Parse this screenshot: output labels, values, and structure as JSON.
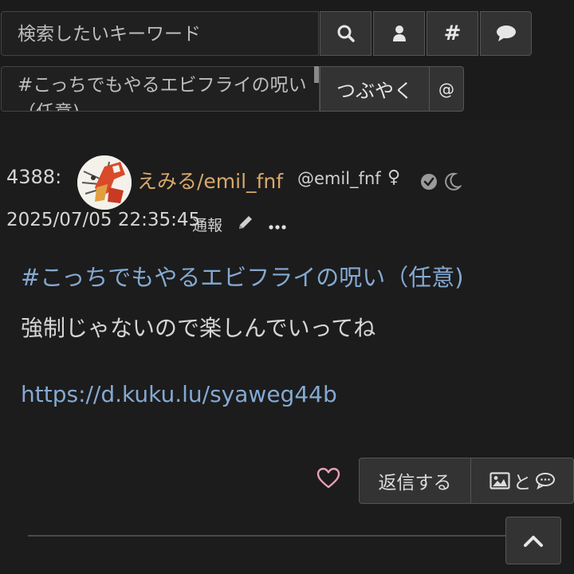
{
  "search": {
    "placeholder": "検索したいキーワード"
  },
  "toolbar": {
    "search_icon": "search-icon",
    "user_icon": "user-icon",
    "hashtag_label": "#",
    "comment_icon": "speech-bubble-icon"
  },
  "composer": {
    "value": "#こっちでもやるエビフライの呪い（任意)",
    "submit_label": "つぶやく",
    "mention_label": "@"
  },
  "post": {
    "number": "4388:",
    "display_name": "えみる/emil_fnf",
    "handle": "@emil_fnf",
    "gender_symbol": "♀",
    "timestamp": "2025/07/05 22:35:45",
    "report_label": "通報",
    "hashtag": "#こっちでもやるエビフライの呪い（任意)",
    "body": "強制じゃないので楽しんでいってね",
    "url": "https://d.kuku.lu/syaweg44b",
    "reply_label": "返信する",
    "image_reply_label": "と"
  },
  "colors": {
    "background": "#1c1c1c",
    "link": "#84a9d2",
    "display_name": "#d9a86c",
    "heart": "#e8a0b8",
    "button": "#333333"
  }
}
